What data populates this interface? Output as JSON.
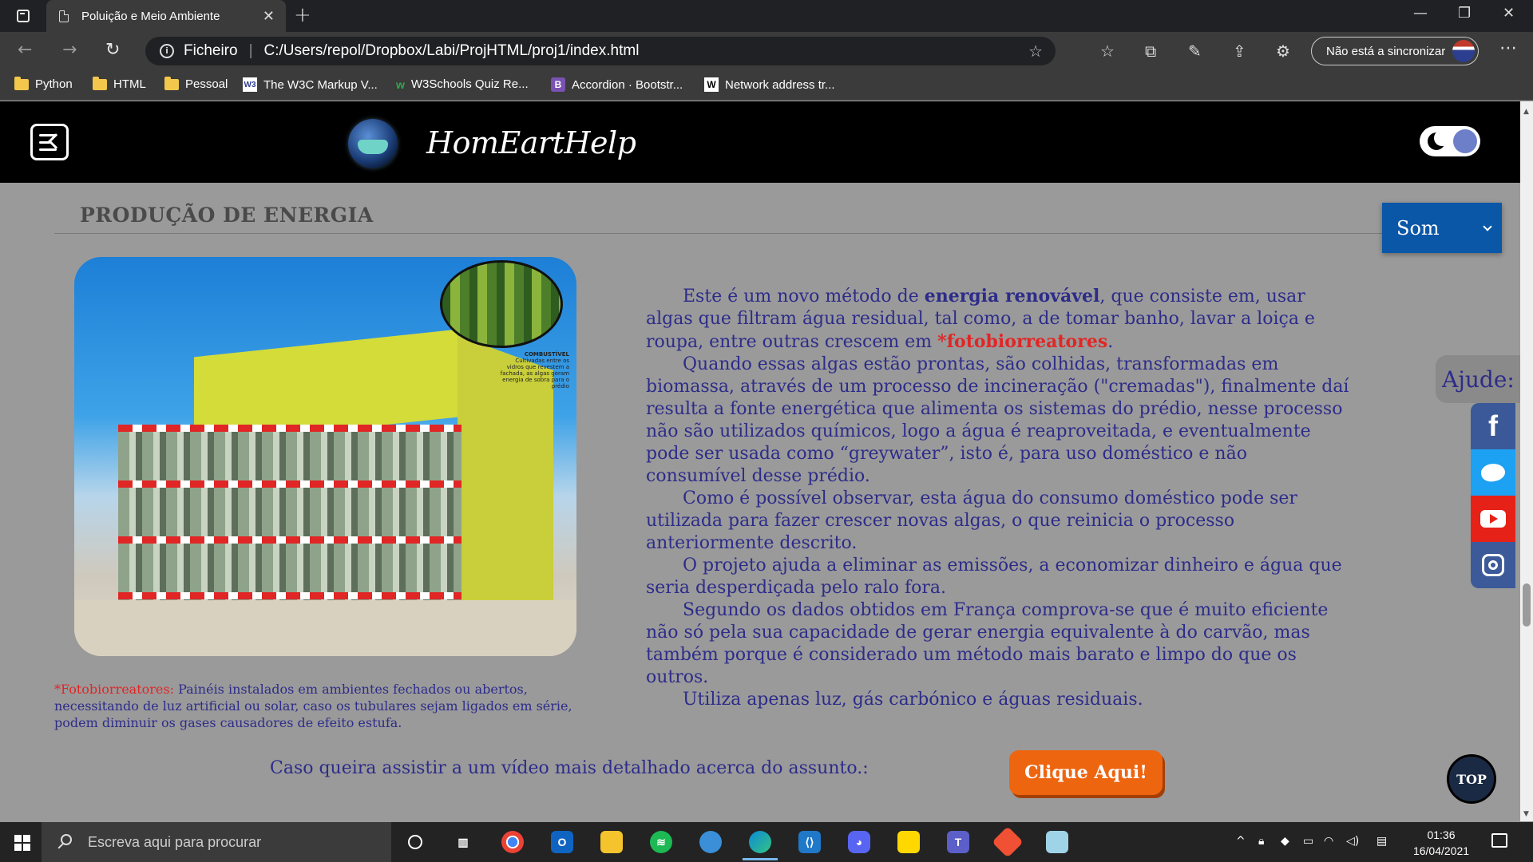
{
  "browser": {
    "tab_title": "Poluição e Meio Ambiente",
    "address_prefix": "Ficheiro",
    "address_url": "C:/Users/repol/Dropbox/Labi/ProjHTML/proj1/index.html",
    "sync_label": "Não está a sincronizar",
    "bookmarks": [
      {
        "label": "Python",
        "icon": "folder-icon"
      },
      {
        "label": "HTML",
        "icon": "folder-icon"
      },
      {
        "label": "Pessoal",
        "icon": "folder-icon"
      },
      {
        "label": "The W3C Markup V...",
        "icon": "w3c-icon"
      },
      {
        "label": "W3Schools Quiz Re...",
        "icon": "w3schools-icon"
      },
      {
        "label": "Accordion · Bootstr...",
        "icon": "bootstrap-icon"
      },
      {
        "label": "Network address tr...",
        "icon": "wikipedia-icon"
      }
    ]
  },
  "site": {
    "logo_text": "HomEartHelp",
    "section_title": "PRODUÇÃO DE ENERGIA",
    "image_caption_title": "COMBUSTÍVEL",
    "image_caption_text": "Cultivadas entre os vidros que revestem a fachada, as algas geram energia de sobra para o prédio",
    "footnote_term": "*Fotobiorreatores:",
    "footnote_text": " Painéis instalados em ambientes fechados ou abertos, necessitando de luz artificial ou solar, caso os tubulares sejam ligados em série, podem diminuir os gases causadores de efeito estufa.",
    "p1_a": "Este é um novo método de ",
    "p1_bold": "energia renovável",
    "p1_b": ", que consiste em, usar algas que filtram água residual, tal como, a de tomar banho, lavar a loiça e roupa, entre outras crescem em ",
    "p1_red": "*fotobiorreatores",
    "p1_c": ".",
    "p2": "Quando essas algas estão prontas, são colhidas, transformadas em biomassa, através de um processo de incineração (\"cremadas\"), finalmente daí resulta a fonte energética que alimenta os sistemas do prédio, nesse processo não são utilizados químicos, logo a água é reaproveitada, e eventualmente pode ser usada como “greywater”, isto é, para uso doméstico e não consumível desse prédio.",
    "p3": "Como é possível observar, esta água do consumo doméstico pode ser utilizada para fazer crescer novas algas, o que reinicia o processo anteriormente descrito.",
    "p4": "O projeto ajuda a eliminar as emissões, a economizar dinheiro e água que seria desperdiçada pelo ralo fora.",
    "p5": "Segundo os dados obtidos em França comprova-se que é muito eficiente não só pela sua capacidade de gerar energia equivalente à do carvão, mas também porque é considerado um método mais barato e limpo do que os outros.",
    "p6": "Utiliza apenas luz, gás carbónico e águas residuais.",
    "video_text": "Caso queira assistir a um vídeo mais detalhado acerca do assunto.:",
    "cta_label": "Clique Aqui!",
    "sound_select_value": "Som",
    "help_label": "Ajude:",
    "top_label": "TOP"
  },
  "taskbar": {
    "search_placeholder": "Escreva aqui para procurar",
    "time": "01:36",
    "date": "16/04/2021"
  },
  "colors": {
    "accent_text": "#2d2c8a",
    "highlight_red": "#e12626",
    "cta": "#ee6510",
    "select_bg": "#0a57a8"
  }
}
